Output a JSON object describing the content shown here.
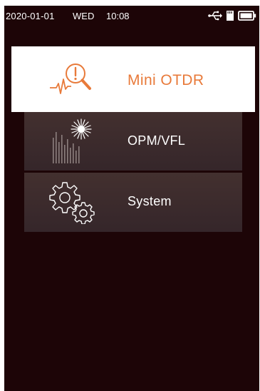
{
  "status_bar": {
    "date": "2020-01-01",
    "day": "WED",
    "time": "10:08",
    "icons": [
      "usb-icon",
      "sd-card-icon",
      "battery-icon"
    ]
  },
  "menu": {
    "items": [
      {
        "label": "Mini OTDR",
        "icon": "otdr-search-icon",
        "selected": true
      },
      {
        "label": "OPM/VFL",
        "icon": "opm-vfl-icon",
        "selected": false
      },
      {
        "label": "System",
        "icon": "gears-icon",
        "selected": false
      }
    ]
  },
  "colors": {
    "background": "#1d0507",
    "selected_bg": "#ffffff",
    "accent": "#e87a3a",
    "item_bg": "#3a2a29",
    "text": "#ffffff"
  }
}
